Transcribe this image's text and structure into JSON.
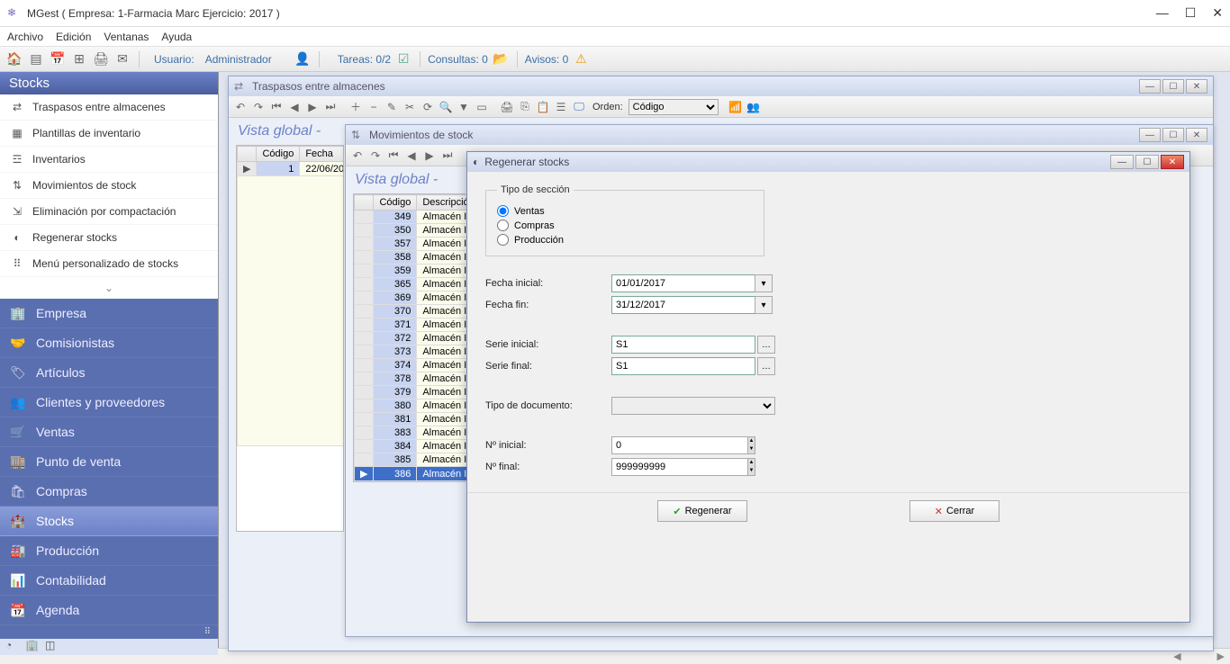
{
  "window": {
    "title": "MGest ( Empresa: 1-Farmacia Marc Ejercicio: 2017 )"
  },
  "menubar": [
    "Archivo",
    "Edición",
    "Ventanas",
    "Ayuda"
  ],
  "toolbar": {
    "usuario_label": "Usuario:",
    "usuario_value": "Administrador",
    "tareas": "Tareas: 0/2",
    "consultas": "Consultas: 0",
    "avisos": "Avisos: 0"
  },
  "sidebar": {
    "header": "Stocks",
    "tree": [
      "Traspasos entre almacenes",
      "Plantillas de inventario",
      "Inventarios",
      "Movimientos de stock",
      "Eliminación por compactación",
      "Regenerar stocks",
      "Menú personalizado de stocks"
    ],
    "nav": [
      "Empresa",
      "Comisionistas",
      "Artículos",
      "Clientes y proveedores",
      "Ventas",
      "Punto de venta",
      "Compras",
      "Stocks",
      "Producción",
      "Contabilidad",
      "Agenda"
    ],
    "nav_selected_index": 7
  },
  "traspasos_window": {
    "title": "Traspasos entre almacenes",
    "orden_label": "Orden:",
    "orden_value": "Código",
    "vista": "Vista global  -",
    "grid_headers": [
      "Código",
      "Fecha"
    ],
    "grid_rows": [
      {
        "codigo": "1",
        "fecha": "22/06/20"
      }
    ]
  },
  "movimientos_window": {
    "title": "Movimientos de stock",
    "vista": "Vista global  -",
    "grid_headers": [
      "Código",
      "Descripció"
    ],
    "grid_rows": [
      {
        "codigo": "349",
        "desc": "Almacén I"
      },
      {
        "codigo": "350",
        "desc": "Almacén I"
      },
      {
        "codigo": "357",
        "desc": "Almacén I"
      },
      {
        "codigo": "358",
        "desc": "Almacén I"
      },
      {
        "codigo": "359",
        "desc": "Almacén I"
      },
      {
        "codigo": "365",
        "desc": "Almacén I"
      },
      {
        "codigo": "369",
        "desc": "Almacén I"
      },
      {
        "codigo": "370",
        "desc": "Almacén I"
      },
      {
        "codigo": "371",
        "desc": "Almacén I"
      },
      {
        "codigo": "372",
        "desc": "Almacén I"
      },
      {
        "codigo": "373",
        "desc": "Almacén I"
      },
      {
        "codigo": "374",
        "desc": "Almacén I"
      },
      {
        "codigo": "378",
        "desc": "Almacén I"
      },
      {
        "codigo": "379",
        "desc": "Almacén I"
      },
      {
        "codigo": "380",
        "desc": "Almacén I"
      },
      {
        "codigo": "381",
        "desc": "Almacén I"
      },
      {
        "codigo": "383",
        "desc": "Almacén I"
      },
      {
        "codigo": "384",
        "desc": "Almacén I"
      },
      {
        "codigo": "385",
        "desc": "Almacén I"
      },
      {
        "codigo": "386",
        "desc": "Almacén I"
      }
    ],
    "selected_index": 19
  },
  "dialog": {
    "title": "Regenerar stocks",
    "seccion_legend": "Tipo de sección",
    "radios": [
      "Ventas",
      "Compras",
      "Producción"
    ],
    "radio_selected": 0,
    "labels": {
      "fecha_ini": "Fecha inicial:",
      "fecha_fin": "Fecha fin:",
      "serie_ini": "Serie inicial:",
      "serie_fin": "Serie final:",
      "tipo_doc": "Tipo de documento:",
      "no_ini": "Nº inicial:",
      "no_fin": "Nº final:"
    },
    "values": {
      "fecha_ini": "01/01/2017",
      "fecha_fin": "31/12/2017",
      "serie_ini": "S1",
      "serie_fin": "S1",
      "tipo_doc": "",
      "no_ini": "0",
      "no_fin": "999999999"
    },
    "buttons": {
      "regenerar": "Regenerar",
      "cerrar": "Cerrar"
    }
  }
}
